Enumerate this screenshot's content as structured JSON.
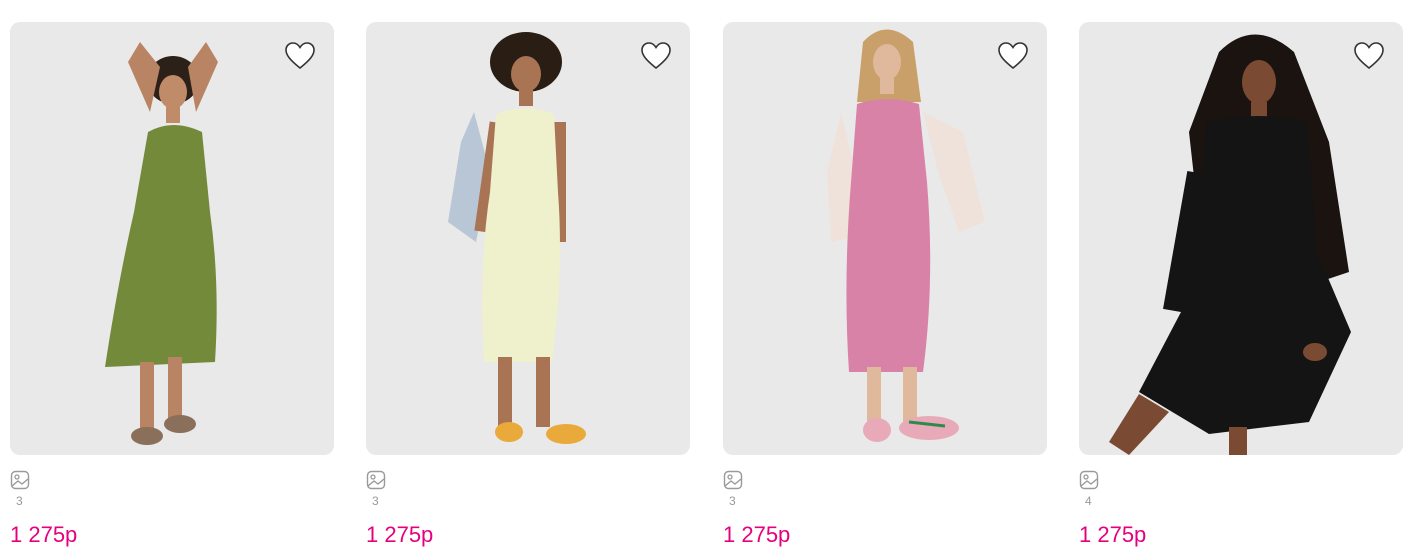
{
  "products": [
    {
      "photo_count": "3",
      "price": "1 275р",
      "dress_color": "#738a3b",
      "dress_style": "sleeveless midi",
      "shoe_color": "#8a6f5a"
    },
    {
      "photo_count": "3",
      "price": "1 275р",
      "dress_color": "#eff0cc",
      "dress_style": "sleeveless midi",
      "shoe_color": "#e9a93b"
    },
    {
      "photo_count": "3",
      "price": "1 275р",
      "dress_color": "#d982a8",
      "dress_style": "sleeveless midi",
      "shoe_color": "#e8a9b9"
    },
    {
      "photo_count": "4",
      "price": "1 275р",
      "dress_color": "#141414",
      "dress_style": "long-sleeve mini",
      "shoe_color": "#141414"
    }
  ],
  "icons": {
    "favorite": "heart-outline-icon",
    "gallery": "image-gallery-icon"
  },
  "colors": {
    "price": "#e6007e",
    "photo_background": "#e9e9ea",
    "count_text": "#9a9a9a"
  }
}
